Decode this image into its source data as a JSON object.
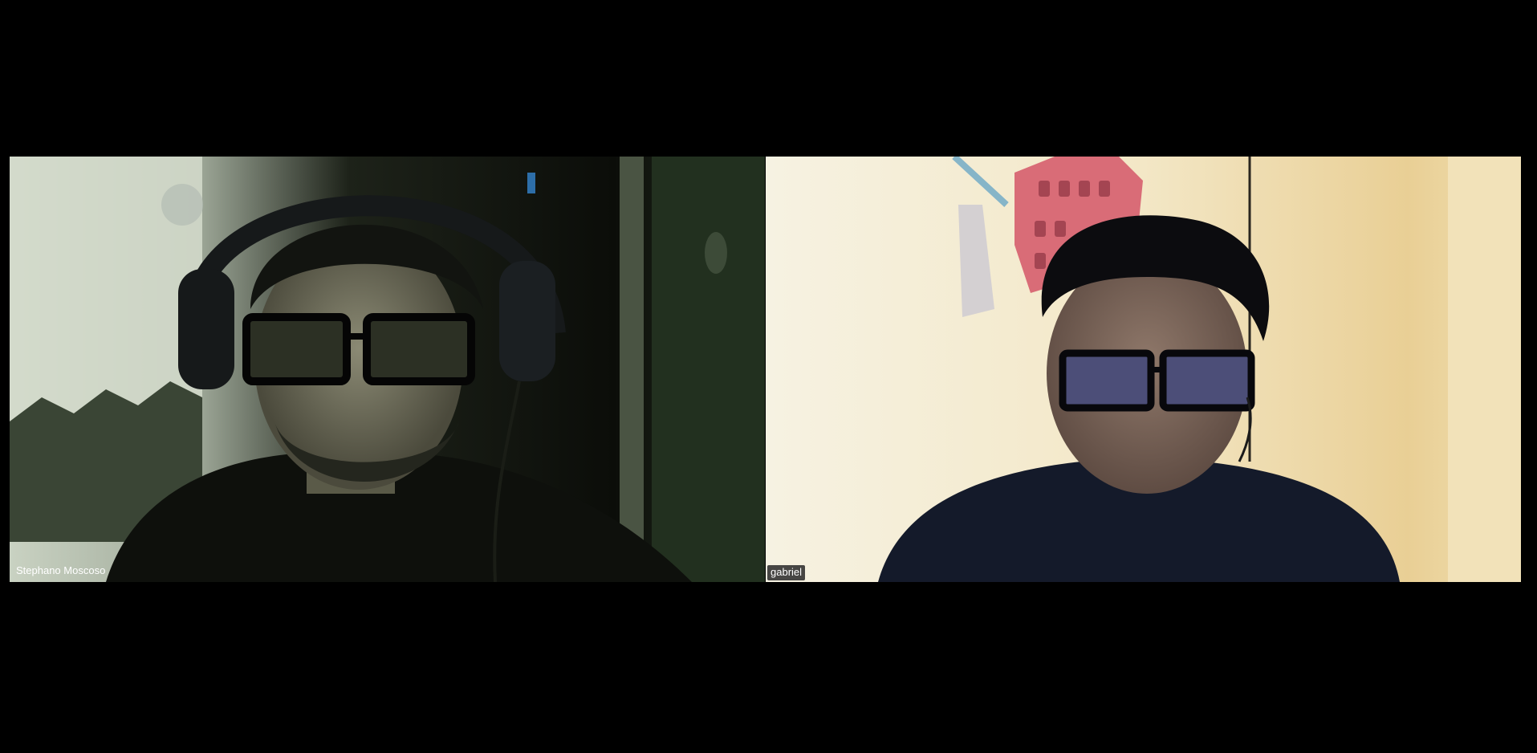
{
  "meeting": {
    "participants": [
      {
        "name": "Stephano Moscoso",
        "video": "webcam-feed"
      },
      {
        "name": "gabriel",
        "video": "webcam-feed"
      }
    ]
  },
  "icons": {
    "left_tile": "person-video-icon",
    "right_tile": "person-video-icon"
  },
  "colors": {
    "background": "#000000",
    "name_tag_text": "#ffffff",
    "name_tag_box": "#282828"
  }
}
